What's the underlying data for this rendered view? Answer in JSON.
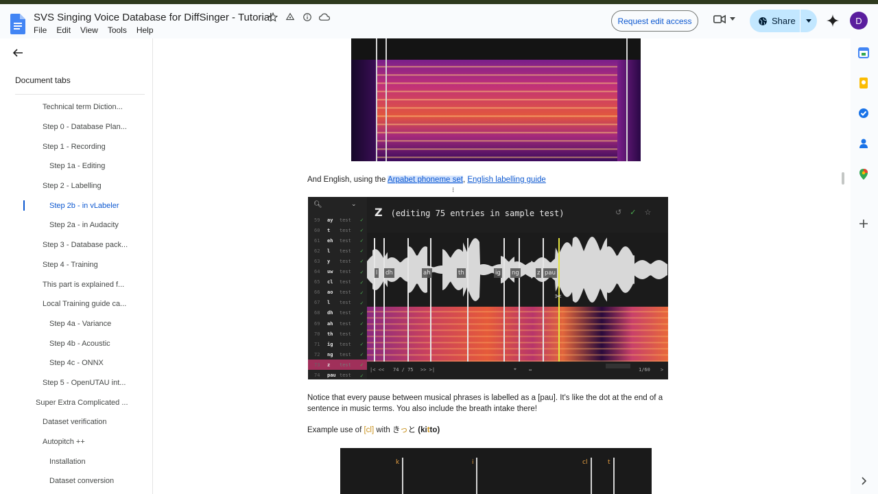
{
  "header": {
    "title": "SVS Singing Voice Database for DiffSinger - Tutorial",
    "menu": [
      "File",
      "Edit",
      "View",
      "Tools",
      "Help"
    ],
    "request_edit": "Request edit access",
    "share": "Share",
    "avatar_initial": "D"
  },
  "sidebar": {
    "title": "Document tabs",
    "items": [
      {
        "label": "Technical term Diction...",
        "indent": 1
      },
      {
        "label": "Step 0 - Database Plan...",
        "indent": 1
      },
      {
        "label": "Step 1 - Recording",
        "indent": 1
      },
      {
        "label": "Step 1a - Editing",
        "indent": 2
      },
      {
        "label": "Step 2 - Labelling",
        "indent": 1
      },
      {
        "label": "Step 2b - in vLabeler",
        "indent": 2,
        "active": true
      },
      {
        "label": "Step 2a - in Audacity",
        "indent": 2
      },
      {
        "label": "Step 3 - Database pack...",
        "indent": 1
      },
      {
        "label": "Step 4 - Training",
        "indent": 1
      },
      {
        "label": "This part is explained f...",
        "indent": 1
      },
      {
        "label": "Local Training guide ca...",
        "indent": 1
      },
      {
        "label": "Step 4a - Variance",
        "indent": 2
      },
      {
        "label": "Step 4b - Acoustic",
        "indent": 2
      },
      {
        "label": "Step 4c - ONNX",
        "indent": 2
      },
      {
        "label": "Step 5 - OpenUTAU int...",
        "indent": 1
      },
      {
        "label": "Super Extra Complicated ...",
        "indent": 0
      },
      {
        "label": "Dataset verification",
        "indent": 1
      },
      {
        "label": "Autopitch ++",
        "indent": 1
      },
      {
        "label": "Installation",
        "indent": 2
      },
      {
        "label": "Dataset conversion",
        "indent": 2
      }
    ]
  },
  "content": {
    "english_prefix": "And English, using the ",
    "link_arpabet": "Arpabet phoneme set",
    "comma": ", ",
    "link_guide": "English labelling guide",
    "pause_text": "Notice that every pause between musical phrases is labelled as a [pau]. It's like the dot at the end of a sentence in music terms. You also include the breath intake there!",
    "example_prefix": "Example use of ",
    "example_cl": "[cl]",
    "example_mid": " with ",
    "example_kana_pre": "き",
    "example_kana_small": "っ",
    "example_kana_post": "と",
    "example_romaji_pre": " (ki",
    "example_romaji_mid": "t",
    "example_romaji_post": "to)"
  },
  "vlabeler": {
    "title_letter": "Z",
    "title_text": "(editing 75 entries in sample test)",
    "rows": [
      {
        "n": "59",
        "p": "ay",
        "t": "test"
      },
      {
        "n": "60",
        "p": "t",
        "t": "test"
      },
      {
        "n": "61",
        "p": "eh",
        "t": "test"
      },
      {
        "n": "62",
        "p": "l",
        "t": "test"
      },
      {
        "n": "63",
        "p": "y",
        "t": "test"
      },
      {
        "n": "64",
        "p": "uw",
        "t": "test"
      },
      {
        "n": "65",
        "p": "cl",
        "t": "test"
      },
      {
        "n": "66",
        "p": "ao",
        "t": "test"
      },
      {
        "n": "67",
        "p": "l",
        "t": "test"
      },
      {
        "n": "68",
        "p": "dh",
        "t": "test"
      },
      {
        "n": "69",
        "p": "ah",
        "t": "test"
      },
      {
        "n": "70",
        "p": "th",
        "t": "test"
      },
      {
        "n": "71",
        "p": "ig",
        "t": "test"
      },
      {
        "n": "72",
        "p": "ng",
        "t": "test"
      },
      {
        "n": "73",
        "p": "z",
        "t": "test",
        "selected": true
      },
      {
        "n": "74",
        "p": "pau",
        "t": "test"
      }
    ],
    "phonemes": [
      "l",
      "dh",
      "ah",
      "th",
      "ig",
      "ng",
      "z",
      "pau"
    ],
    "bottom_nav": "74 / 75",
    "bottom_page": "1/60"
  },
  "bottom_shot": {
    "labels": [
      "k",
      "i",
      "cl",
      "t"
    ]
  }
}
